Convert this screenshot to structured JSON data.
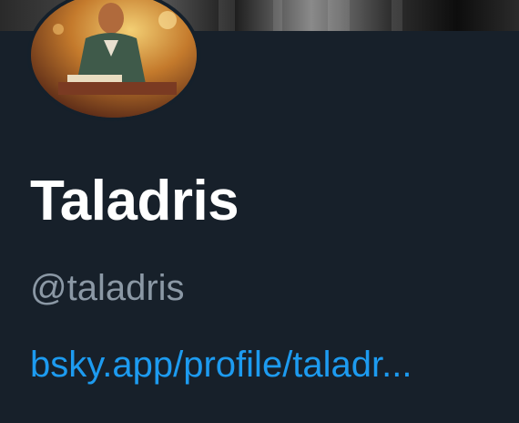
{
  "profile": {
    "display_name": "Taladris",
    "handle": "@taladris",
    "link_text": "bsky.app/profile/taladr..."
  },
  "colors": {
    "background": "#17202a",
    "display_name": "#ffffff",
    "handle": "#8b98a5",
    "link": "#1d9bf0"
  },
  "images": {
    "banner": "banner-photo",
    "avatar": "avatar-photo"
  }
}
